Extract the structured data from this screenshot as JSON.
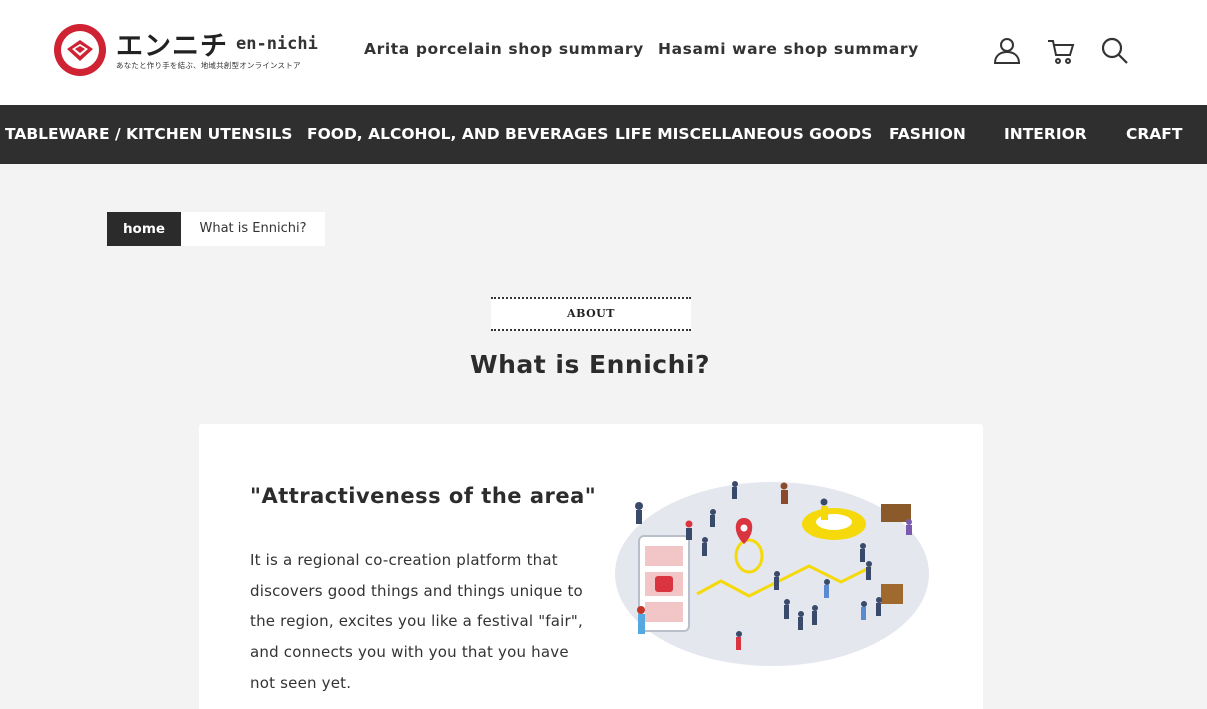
{
  "header": {
    "logo": {
      "jp": "エンニチ",
      "en": "en-nichi",
      "tagline": "あなたと作り手を結ぶ、地域共創型オンラインストア"
    },
    "links": [
      "Arita porcelain shop summary",
      "Hasami ware shop summary"
    ],
    "icons": [
      "user-icon",
      "cart-icon",
      "search-icon"
    ]
  },
  "categories": [
    "TABLEWARE / KITCHEN UTENSILS",
    "FOOD, ALCOHOL, AND BEVERAGES",
    "LIFE MISCELLANEOUS GOODS",
    "FASHION",
    "INTERIOR",
    "CRAFT"
  ],
  "breadcrumb": {
    "home": "home",
    "current": "What is Ennichi?"
  },
  "section": {
    "label": "ABOUT",
    "title": "What is Ennichi?"
  },
  "card": {
    "heading": "\"Attractiveness of the area\"",
    "body": "It is a regional co-creation platform that discovers good things and things unique to the region, excites you like a festival \"fair\", and connects you with you that you have not seen yet."
  },
  "colors": {
    "brand_red": "#cf2233",
    "nav_bg": "#2f2f2f",
    "page_bg": "#f3f3f3",
    "accent_yellow": "#f5d90a"
  }
}
